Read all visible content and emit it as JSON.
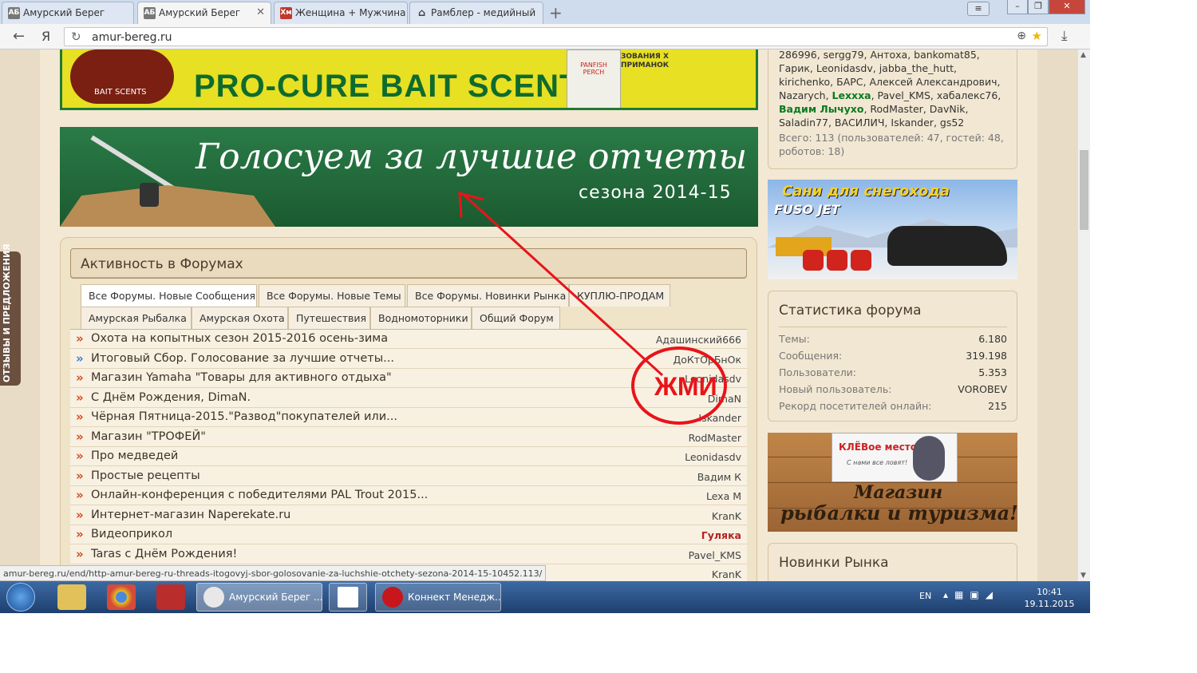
{
  "browser": {
    "tabs": [
      {
        "label": "Амурский Берег",
        "icon": "ab-favicon",
        "active": false
      },
      {
        "label": "Амурский Берег",
        "icon": "ab-favicon",
        "active": true
      },
      {
        "label": "Женщина + Мужчина",
        "icon": "hm-favicon",
        "active": false
      },
      {
        "label": "Рамблер - медийный",
        "icon": "home-icon",
        "active": false
      }
    ],
    "url": "amur-bereg.ru",
    "nav_yandex_label": "Я",
    "status_url": "amur-bereg.ru/end/http-amur-bereg-ru-threads-itogovyj-sbor-golosovanie-za-luchshie-otchety-sezona-2014-15-10452.113/"
  },
  "banners": {
    "top_text": "PRO-CURE BAIT SCENTS",
    "top_logo": "BAIT SCENTS",
    "top_jar": "PANFISH PERCH",
    "top_small": "ЗОВАНИЯ Х ПРИМАНОК",
    "vote_line1": "Голосуем за лучшие отчеты",
    "vote_line2": "сезона 2014-15"
  },
  "feedback_tab": "ОТЗЫВЫ И ПРЕДЛОЖЕНИЯ",
  "forum_activity": {
    "title": "Активность в Форумах",
    "tabs_row1": [
      "Все Форумы. Новые Сообщения",
      "Все Форумы. Новые Темы",
      "Все Форумы. Новинки Рынка",
      "КУПЛЮ-ПРОДАМ"
    ],
    "tabs_row2": [
      "Амурская Рыбалка",
      "Амурская Охота",
      "Путешествия",
      "Водномоторники",
      "Общий Форум"
    ],
    "threads": [
      {
        "title": "Охота на копытных сезон 2015-2016 осень-зима",
        "user": "Адашинский666",
        "arrow": "red"
      },
      {
        "title": "Итоговый Сбор. Голосование за лучшие отчеты...",
        "user": "ДоКтОрБнОк",
        "arrow": "blue"
      },
      {
        "title": "Магазин Yamaha \"Товары для активного отдыха\"",
        "user": "Leonidasdv",
        "arrow": "red"
      },
      {
        "title": "С Днём Рождения, DimaN.",
        "user": "DimaN",
        "arrow": "red"
      },
      {
        "title": "Чёрная Пятница-2015.\"Развод\"покупателей или...",
        "user": "Iskander",
        "arrow": "red"
      },
      {
        "title": "Магазин \"ТРОФЕЙ\"",
        "user": "RodMaster",
        "arrow": "red"
      },
      {
        "title": "Про медведей",
        "user": "Leonidasdv",
        "arrow": "red"
      },
      {
        "title": "Простые рецепты",
        "user": "Вадим К",
        "arrow": "red"
      },
      {
        "title": "Онлайн-конференция с победителями PAL Trout 2015...",
        "user": "Lexa M",
        "arrow": "red"
      },
      {
        "title": "Интернет-магазин Naperekate.ru",
        "user": "KranK",
        "arrow": "red"
      },
      {
        "title": "Видеоприкол",
        "user": "Гуляка",
        "arrow": "red",
        "highlight": true
      },
      {
        "title": "Taras с Днём Рождения!",
        "user": "Pavel_KMS",
        "arrow": "red"
      },
      {
        "title": "",
        "user": "KranK",
        "arrow": "red"
      }
    ]
  },
  "online": {
    "names_a": "286996, sergg79, Антоха, bankomat85, Гарик, Leonidasdv, jabba_the_hutt, kirichenko, БАРС, Алексей Александрович, Nazarych, ",
    "names_b1": "Lexxxa",
    "names_c": ", Pavel_KMS, хабалекс76, ",
    "names_b2": "Вадим Лычухо",
    "names_d": ", RodMaster, DavNik, Saladin77, ВАСИЛИЧ, Iskander, gs52",
    "total": "Всего: 113 (пользователей: 47, гостей: 48, роботов: 18)"
  },
  "ad_sani": {
    "line1": "Сани для снегохода",
    "line2": "FUSO JET"
  },
  "stats": {
    "title": "Статистика форума",
    "rows": [
      {
        "label": "Темы:",
        "value": "6.180"
      },
      {
        "label": "Сообщения:",
        "value": "319.198"
      },
      {
        "label": "Пользователи:",
        "value": "5.353"
      },
      {
        "label": "Новый пользователь:",
        "value": "VOROBEV"
      },
      {
        "label": "Рекорд посетителей онлайн:",
        "value": "215"
      }
    ]
  },
  "ad_shop": {
    "label": "КЛЁВое место",
    "sublabel": "С нами все ловят!",
    "line1": "Магазин",
    "line2": "рыбалки и туризма!"
  },
  "new_market_title": "Новинки Рынка",
  "annotation": {
    "text": "ЖМИ",
    "color": "#e8141a"
  },
  "taskbar": {
    "tasks": [
      {
        "label": "Амурский Берег ...",
        "active": true
      },
      {
        "label": "",
        "active": false
      },
      {
        "label": "Коннект Менедж...",
        "active": false
      }
    ],
    "lang": "EN",
    "time": "10:41",
    "date": "19.11.2015"
  }
}
